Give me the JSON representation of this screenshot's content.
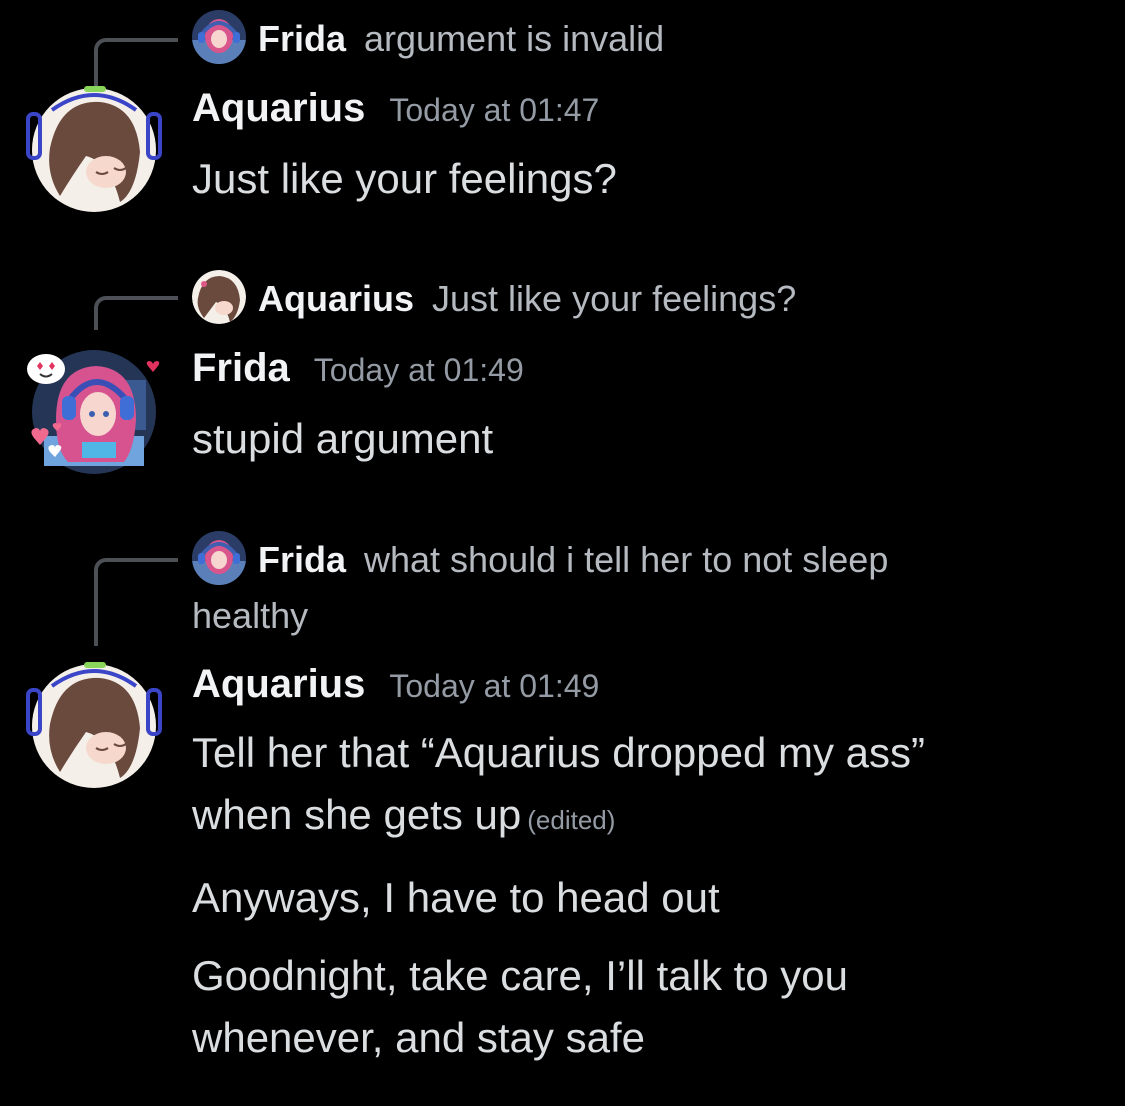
{
  "messages": [
    {
      "reply": {
        "author": "Frida",
        "text": "argument is invalid",
        "avatar_icon": "frida-avatar-icon"
      },
      "author": "Aquarius",
      "timestamp": "Today at 01:47",
      "avatar_icon": "aquarius-avatar-icon",
      "lines": [
        "Just like your feelings?"
      ]
    },
    {
      "reply": {
        "author": "Aquarius",
        "text": "Just like your feelings?",
        "avatar_icon": "aquarius-avatar-icon"
      },
      "author": "Frida",
      "timestamp": "Today at 01:49",
      "avatar_icon": "frida-avatar-icon",
      "lines": [
        "stupid argument"
      ]
    },
    {
      "reply": {
        "author": "Frida",
        "text": "what should i tell her to not sleep healthy",
        "avatar_icon": "frida-avatar-icon"
      },
      "author": "Aquarius",
      "timestamp": "Today at 01:49",
      "avatar_icon": "aquarius-avatar-icon",
      "lines": [
        "Tell her that “Aquarius dropped my ass” when she gets up",
        "Anyways, I have to head out",
        "Goodnight, take care, I’ll talk to you whenever, and stay safe"
      ],
      "edited_label": "(edited)"
    }
  ],
  "colors": {
    "background": "#000000",
    "name": "#f2f3f5",
    "text": "#dbdee1",
    "muted": "#949ba4",
    "reply_spine": "#4e5058"
  }
}
